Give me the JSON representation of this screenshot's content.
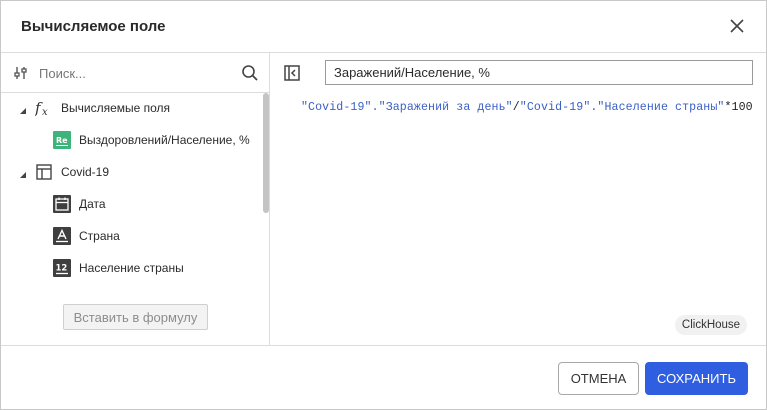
{
  "dialog": {
    "title": "Вычисляемое поле",
    "close_icon": "close-icon"
  },
  "left_panel": {
    "search_placeholder": "Поиск...",
    "tree": [
      {
        "label": "Вычисляемые поля",
        "icon": "function-icon",
        "expanded": true,
        "level": 0
      },
      {
        "label": "Выздоровлений/Население, %",
        "icon": "calculated-field-icon",
        "level": 1
      },
      {
        "label": "Covid-19",
        "icon": "table-icon",
        "expanded": true,
        "level": 0
      },
      {
        "label": "Дата",
        "icon": "date-icon",
        "level": 1
      },
      {
        "label": "Страна",
        "icon": "text-field-icon",
        "level": 1
      },
      {
        "label": "Население страны",
        "icon": "number-field-icon",
        "level": 1
      }
    ],
    "insert_button": "Вставить в формулу"
  },
  "right_panel": {
    "field_name": "Заражений/Население, %",
    "formula": {
      "part1": "\"Covid-19\".\"Заражений за день\"",
      "op1": "/",
      "part2": "\"Covid-19\".\"Население страны\"",
      "op2": "*100"
    },
    "db_badge": "ClickHouse"
  },
  "footer": {
    "cancel": "ОТМЕНА",
    "save": "СОХРАНИТЬ"
  },
  "colors": {
    "accent": "#2f5fe0",
    "formula_string": "#3a5fc7",
    "calc_icon_bg": "#3fb47a"
  }
}
